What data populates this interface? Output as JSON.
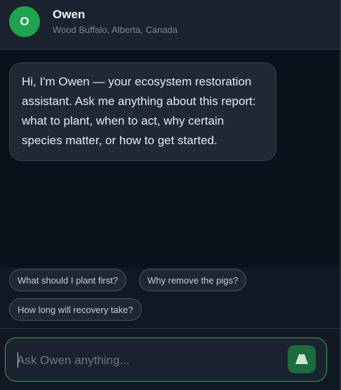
{
  "assistant": {
    "avatar_initial": "O",
    "name": "Owen",
    "location": "Wood Buffalo, Alberta, Canada"
  },
  "messages": [
    {
      "role": "assistant",
      "text": "Hi, I'm Owen — your ecosystem restoration assistant. Ask me anything about this report: what to plant, when to act, why certain species matter, or how to get started."
    }
  ],
  "suggestions": [
    "What should I plant first?",
    "Why remove the pigs?",
    "How long will recovery take?"
  ],
  "composer": {
    "placeholder": "Ask Owen anything...",
    "value": "",
    "send_icon": "send-icon"
  },
  "colors": {
    "accent": "#1fa34f",
    "border_focus": "#2ea55e",
    "send_button": "#1e6b3b"
  }
}
